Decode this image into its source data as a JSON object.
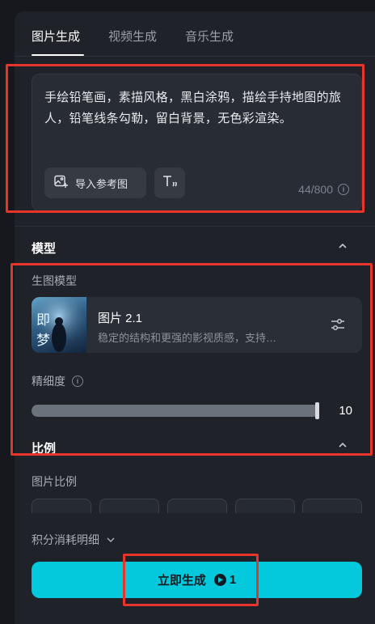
{
  "tabs": [
    {
      "label": "图片生成",
      "active": true
    },
    {
      "label": "视频生成",
      "active": false
    },
    {
      "label": "音乐生成",
      "active": false
    }
  ],
  "prompt": {
    "text": "手绘铅笔画，素描风格，黑白涂鸦，描绘手持地图的旅人，铅笔线条勾勒，留白背景，无色彩渲染。",
    "import_ref_label": "导入参考图",
    "counter": "44/800"
  },
  "model_section": {
    "title": "模型",
    "sub_label": "生图模型",
    "model_name": "图片 2.1",
    "model_desc": "稳定的结构和更强的影视质感，支持…",
    "thumb_text": "即 梦",
    "detail_label": "精细度",
    "detail_value": "10",
    "detail_fraction": 1.0
  },
  "ratio_section": {
    "title": "比例",
    "sub_label": "图片比例"
  },
  "cost": {
    "label": "积分消耗明细"
  },
  "generate": {
    "label": "立即生成",
    "cost_value": "1"
  },
  "colors": {
    "accent": "#04c8dc",
    "highlight": "#e8342a",
    "panel_bg": "#1f2229"
  },
  "icons": [
    "image-import-icon",
    "text-format-icon",
    "info-icon",
    "chevron-up-icon",
    "settings-sliders-icon",
    "chevron-down-icon",
    "coin-icon"
  ]
}
